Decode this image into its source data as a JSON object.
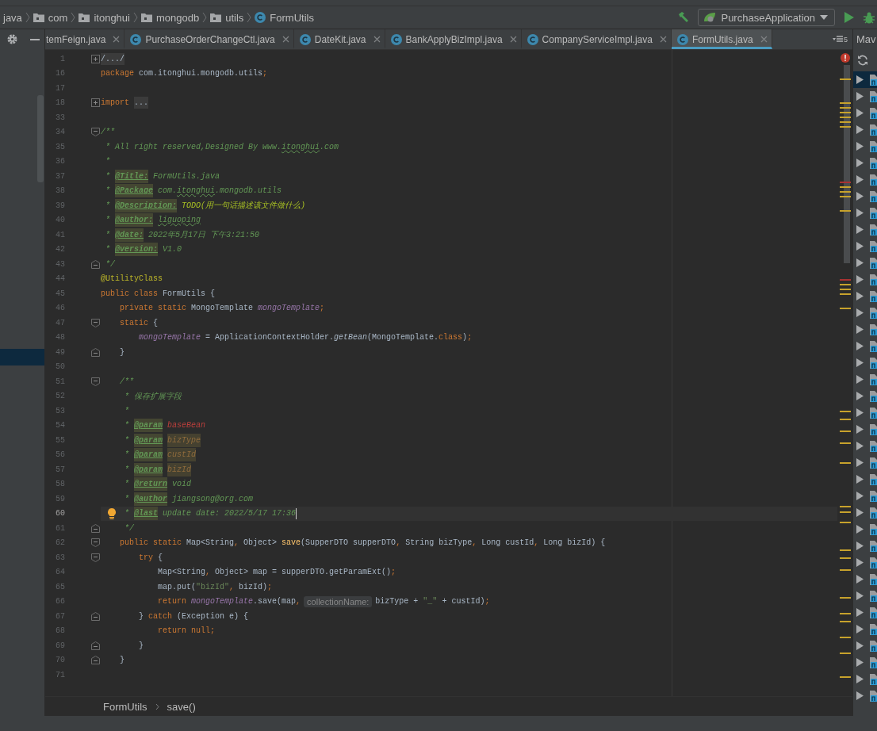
{
  "nav_bar": {
    "breadcrumbs": [
      {
        "label": "java",
        "kind": "plain"
      },
      {
        "label": "com",
        "kind": "folder"
      },
      {
        "label": "itonghui",
        "kind": "folder"
      },
      {
        "label": "mongodb",
        "kind": "folder"
      },
      {
        "label": "utils",
        "kind": "folder"
      },
      {
        "label": "FormUtils",
        "kind": "class"
      }
    ],
    "run_config": {
      "name": "PurchaseApplication"
    }
  },
  "tabs": [
    {
      "label": "temFeign.java",
      "selected": false
    },
    {
      "label": "PurchaseOrderChangeCtl.java",
      "selected": false
    },
    {
      "label": "DateKit.java",
      "selected": false
    },
    {
      "label": "BankApplyBizImpl.java",
      "selected": false
    },
    {
      "label": "CompanyServiceImpl.java",
      "selected": false
    },
    {
      "label": "FormUtils.java",
      "selected": true
    }
  ],
  "tab_overflow": {
    "count": "5"
  },
  "editor": {
    "lines": [
      {
        "number": "1",
        "current": false,
        "fold": {
          "kind": "collapsed"
        },
        "tokens": [
          {
            "kind": "folded",
            "text": "/.../"
          }
        ]
      },
      {
        "number": "16",
        "current": false,
        "tokens": [
          {
            "kind": "keyword",
            "text": "package"
          },
          {
            "kind": "plain",
            "text": " com.itonghui.mongodb.utils"
          },
          {
            "kind": "punct",
            "text": ";"
          }
        ]
      },
      {
        "number": "17",
        "current": false
      },
      {
        "number": "18",
        "current": false,
        "fold": {
          "kind": "collapsed"
        },
        "tokens": [
          {
            "kind": "keyword",
            "text": "import"
          },
          {
            "kind": "folded",
            "text": "..."
          }
        ]
      },
      {
        "number": "33",
        "current": false
      },
      {
        "number": "34",
        "current": false,
        "fold": {
          "kind": "open"
        },
        "tokens": [
          {
            "kind": "doc",
            "text": "/**"
          }
        ]
      },
      {
        "number": "35",
        "current": false,
        "tokens": [
          {
            "kind": "doc",
            "text": " * All right reserved,Designed By www."
          },
          {
            "kind": "doc-typo",
            "text": "itonghui"
          },
          {
            "kind": "doc",
            "text": ".com"
          }
        ]
      },
      {
        "number": "36",
        "current": false,
        "tokens": [
          {
            "kind": "doc",
            "text": " *"
          }
        ]
      },
      {
        "number": "37",
        "current": false,
        "tokens": [
          {
            "kind": "doc",
            "text": " * "
          },
          {
            "kind": "doctag",
            "text": "@Title:"
          },
          {
            "kind": "doc",
            "text": " FormUtils.java"
          }
        ]
      },
      {
        "number": "38",
        "current": false,
        "tokens": [
          {
            "kind": "doc",
            "text": " * "
          },
          {
            "kind": "doctag",
            "text": "@Package"
          },
          {
            "kind": "doc",
            "text": " com."
          },
          {
            "kind": "doc-typo",
            "text": "itonghui"
          },
          {
            "kind": "doc",
            "text": ".mongodb.utils"
          }
        ]
      },
      {
        "number": "39",
        "current": false,
        "tokens": [
          {
            "kind": "doc",
            "text": " * "
          },
          {
            "kind": "doctag",
            "text": "@Description:"
          },
          {
            "kind": "todo",
            "text": " TODO(用一句话描述该文件做什么)"
          }
        ]
      },
      {
        "number": "40",
        "current": false,
        "tokens": [
          {
            "kind": "doc",
            "text": " * "
          },
          {
            "kind": "doctag",
            "text": "@author:"
          },
          {
            "kind": "doc-typo",
            "text": "liguoping"
          }
        ]
      },
      {
        "number": "41",
        "current": false,
        "tokens": [
          {
            "kind": "doc",
            "text": " * "
          },
          {
            "kind": "doctag",
            "text": "@date:"
          },
          {
            "kind": "doc",
            "text": " 2022年5月17日 下午3:21:50"
          }
        ]
      },
      {
        "number": "42",
        "current": false,
        "tokens": [
          {
            "kind": "doc",
            "text": " * "
          },
          {
            "kind": "doctag",
            "text": "@version:"
          },
          {
            "kind": "doc",
            "text": " V1.0"
          }
        ]
      },
      {
        "number": "43",
        "current": false,
        "fold": {
          "kind": "close"
        },
        "tokens": [
          {
            "kind": "doc",
            "text": " */"
          }
        ]
      },
      {
        "number": "44",
        "current": false,
        "tokens": [
          {
            "kind": "annotation",
            "text": "@UtilityClass"
          }
        ]
      },
      {
        "number": "45",
        "current": false,
        "tokens": [
          {
            "kind": "keyword",
            "text": "public class"
          },
          {
            "kind": "plain",
            "text": " FormUtils {"
          }
        ]
      },
      {
        "number": "46",
        "current": false,
        "tokens": [
          {
            "kind": "keyword",
            "text": "    private static"
          },
          {
            "kind": "plain",
            "text": " MongoTemplate "
          },
          {
            "kind": "field",
            "text": "mongoTemplate"
          },
          {
            "kind": "punct",
            "text": ";"
          }
        ]
      },
      {
        "number": "47",
        "current": false,
        "fold": {
          "kind": "open"
        },
        "tokens": [
          {
            "kind": "keyword",
            "text": "    static"
          },
          {
            "kind": "plain",
            "text": " {"
          }
        ]
      },
      {
        "number": "48",
        "current": false,
        "tokens": [
          {
            "kind": "field",
            "text": "        mongoTemplate"
          },
          {
            "kind": "plain",
            "text": " = ApplicationContextHolder."
          },
          {
            "kind": "static-call",
            "text": "getBean"
          },
          {
            "kind": "plain",
            "text": "(MongoTemplate."
          },
          {
            "kind": "keyword",
            "text": "class"
          },
          {
            "kind": "plain",
            "text": ")"
          },
          {
            "kind": "punct",
            "text": ";"
          }
        ]
      },
      {
        "number": "49",
        "current": false,
        "fold": {
          "kind": "close"
        },
        "tokens": [
          {
            "kind": "plain",
            "text": "    }"
          }
        ]
      },
      {
        "number": "50",
        "current": false
      },
      {
        "number": "51",
        "current": false,
        "fold": {
          "kind": "open"
        },
        "tokens": [
          {
            "kind": "doc",
            "text": "    /**"
          }
        ]
      },
      {
        "number": "52",
        "current": false,
        "tokens": [
          {
            "kind": "doc",
            "text": "     * 保存扩展字段"
          }
        ]
      },
      {
        "number": "53",
        "current": false,
        "tokens": [
          {
            "kind": "doc",
            "text": "     *"
          }
        ]
      },
      {
        "number": "54",
        "current": false,
        "tokens": [
          {
            "kind": "doc",
            "text": "     * "
          },
          {
            "kind": "doctag",
            "text": "@param"
          },
          {
            "kind": "param-unknown",
            "text": "baseBean"
          }
        ]
      },
      {
        "number": "55",
        "current": false,
        "tokens": [
          {
            "kind": "doc",
            "text": "     * "
          },
          {
            "kind": "doctag",
            "text": "@param"
          },
          {
            "kind": "param-ref",
            "text": "bizType"
          }
        ]
      },
      {
        "number": "56",
        "current": false,
        "tokens": [
          {
            "kind": "doc",
            "text": "     * "
          },
          {
            "kind": "doctag",
            "text": "@param"
          },
          {
            "kind": "param-ref",
            "text": "custId"
          }
        ]
      },
      {
        "number": "57",
        "current": false,
        "tokens": [
          {
            "kind": "doc",
            "text": "     * "
          },
          {
            "kind": "doctag",
            "text": "@param"
          },
          {
            "kind": "param-ref",
            "text": "bizId"
          }
        ]
      },
      {
        "number": "58",
        "current": false,
        "tokens": [
          {
            "kind": "doc",
            "text": "     * "
          },
          {
            "kind": "doctag",
            "text": "@return"
          },
          {
            "kind": "doc",
            "text": " void"
          }
        ]
      },
      {
        "number": "59",
        "current": false,
        "tokens": [
          {
            "kind": "doc",
            "text": "     * "
          },
          {
            "kind": "doctag",
            "text": "@author"
          },
          {
            "kind": "doc",
            "text": " jiangsong@org.com"
          }
        ]
      },
      {
        "number": "60",
        "current": true,
        "tokens": [
          {
            "kind": "doc",
            "text": "     * "
          },
          {
            "kind": "doctag",
            "text": "@last"
          },
          {
            "kind": "doc",
            "text": " update date: 2022/5/17 17:36"
          }
        ]
      },
      {
        "number": "61",
        "current": false,
        "fold": {
          "kind": "close"
        },
        "tokens": [
          {
            "kind": "doc",
            "text": "     */"
          }
        ]
      },
      {
        "number": "62",
        "current": false,
        "fold": {
          "kind": "open"
        },
        "tokens": [
          {
            "kind": "keyword",
            "text": "    public static"
          },
          {
            "kind": "plain",
            "text": " Map<String"
          },
          {
            "kind": "punct",
            "text": ","
          },
          {
            "kind": "plain",
            "text": " Object> "
          },
          {
            "kind": "method",
            "text": "save"
          },
          {
            "kind": "plain",
            "text": "(SupperDTO supperDTO"
          },
          {
            "kind": "punct",
            "text": ","
          },
          {
            "kind": "plain",
            "text": " String bizType"
          },
          {
            "kind": "punct",
            "text": ","
          },
          {
            "kind": "plain",
            "text": " Long custId"
          },
          {
            "kind": "punct",
            "text": ","
          },
          {
            "kind": "plain",
            "text": " Long bizId) {"
          }
        ]
      },
      {
        "number": "63",
        "current": false,
        "fold": {
          "kind": "open"
        },
        "tokens": [
          {
            "kind": "keyword",
            "text": "        try"
          },
          {
            "kind": "plain",
            "text": " {"
          }
        ]
      },
      {
        "number": "64",
        "current": false,
        "tokens": [
          {
            "kind": "plain",
            "text": "            Map<String"
          },
          {
            "kind": "punct",
            "text": ","
          },
          {
            "kind": "plain",
            "text": " Object> map = supperDTO.getParamExt()"
          },
          {
            "kind": "punct",
            "text": ";"
          }
        ]
      },
      {
        "number": "65",
        "current": false,
        "tokens": [
          {
            "kind": "plain",
            "text": "            map.put("
          },
          {
            "kind": "string",
            "text": "\"bizId\""
          },
          {
            "kind": "punct",
            "text": ","
          },
          {
            "kind": "plain",
            "text": " bizId)"
          },
          {
            "kind": "punct",
            "text": ";"
          }
        ]
      },
      {
        "number": "66",
        "current": false,
        "tokens": [
          {
            "kind": "keyword",
            "text": "            return"
          },
          {
            "kind": "field",
            "text": "mongoTemplate"
          },
          {
            "kind": "plain",
            "text": ".save(map"
          },
          {
            "kind": "punct",
            "text": ","
          },
          {
            "kind": "hint",
            "text": "collectionName:"
          },
          {
            "kind": "plain",
            "text": "bizType + "
          },
          {
            "kind": "string",
            "text": "\"_\""
          },
          {
            "kind": "plain",
            "text": " + custId)"
          },
          {
            "kind": "punct",
            "text": ";"
          }
        ]
      },
      {
        "number": "67",
        "current": false,
        "fold": {
          "kind": "close"
        },
        "tokens": [
          {
            "kind": "plain",
            "text": "        } "
          },
          {
            "kind": "keyword",
            "text": "catch"
          },
          {
            "kind": "plain",
            "text": " (Exception e) {"
          }
        ]
      },
      {
        "number": "68",
        "current": false,
        "tokens": [
          {
            "kind": "keyword",
            "text": "            return null"
          },
          {
            "kind": "punct",
            "text": ";"
          }
        ]
      },
      {
        "number": "69",
        "current": false,
        "fold": {
          "kind": "close"
        },
        "tokens": [
          {
            "kind": "plain",
            "text": "        }"
          }
        ]
      },
      {
        "number": "70",
        "current": false,
        "fold": {
          "kind": "close"
        },
        "tokens": [
          {
            "kind": "plain",
            "text": "    }"
          }
        ]
      },
      {
        "number": "71",
        "current": false
      }
    ]
  },
  "editor_breadcrumbs": [
    "FormUtils",
    "save()"
  ],
  "maven_panel": {
    "title": "Mav",
    "rows": [
      {
        "selected": true
      },
      {
        "selected": false
      },
      {
        "selected": false
      },
      {
        "selected": false
      },
      {
        "selected": false
      },
      {
        "selected": false
      },
      {
        "selected": false
      },
      {
        "selected": false
      },
      {
        "selected": false
      },
      {
        "selected": false
      },
      {
        "selected": false
      },
      {
        "selected": false
      },
      {
        "selected": false
      },
      {
        "selected": false
      },
      {
        "selected": false
      },
      {
        "selected": false
      },
      {
        "selected": false
      },
      {
        "selected": false
      },
      {
        "selected": false
      },
      {
        "selected": false
      },
      {
        "selected": false
      },
      {
        "selected": false
      },
      {
        "selected": false
      },
      {
        "selected": false
      },
      {
        "selected": false
      },
      {
        "selected": false
      },
      {
        "selected": false
      },
      {
        "selected": false
      },
      {
        "selected": false
      },
      {
        "selected": false
      },
      {
        "selected": false
      },
      {
        "selected": false
      },
      {
        "selected": false
      },
      {
        "selected": false
      },
      {
        "selected": false
      },
      {
        "selected": false
      },
      {
        "selected": false
      },
      {
        "selected": false
      }
    ]
  }
}
